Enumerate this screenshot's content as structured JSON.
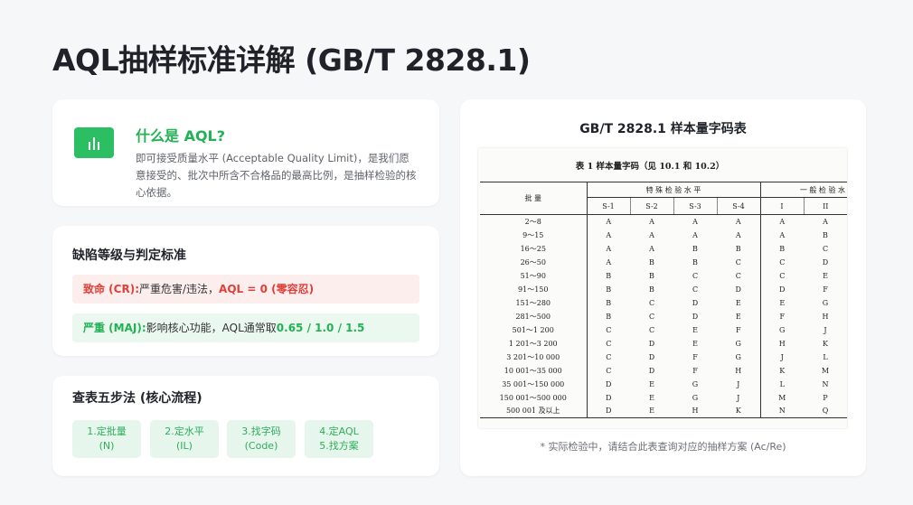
{
  "page": {
    "title": "AQL抽样标准详解 (GB/T 2828.1)"
  },
  "aql_card": {
    "heading": "什么是 AQL?",
    "description": "即可接受质量水平 (Acceptable Quality Limit)，是我们愿意接受的、批次中所含不合格品的最高比例，是抽样检验的核心依据。",
    "icon": "bar-chart-icon"
  },
  "defects": {
    "title": "缺陷等级与判定标准",
    "cr": {
      "label": "致命 (CR):",
      "text": "严重危害/违法，",
      "highlight": "AQL = 0 (零容忍)"
    },
    "maj": {
      "label": "严重 (MAJ):",
      "text": "影响核心功能，AQL通常取",
      "highlight": "0.65 / 1.0 / 1.5"
    }
  },
  "steps": {
    "title": "查表五步法 (核心流程)",
    "items": [
      {
        "line1": "1.定批量",
        "line2": "(N)"
      },
      {
        "line1": "2.定水平",
        "line2": "(IL)"
      },
      {
        "line1": "3.找字码",
        "line2": "(Code)"
      },
      {
        "line1": "4.定AQL",
        "line2": "5.找方案"
      }
    ]
  },
  "table_card": {
    "title": "GB/T 2828.1 样本量字码表",
    "scan_caption": "表 1   样本量字码（见 10.1 和 10.2）",
    "headers": {
      "batch": "批      量",
      "special": "特 殊 检 验 水 平",
      "general": "一 般 检 验 水",
      "sub": [
        "S-1",
        "S-2",
        "S-3",
        "S-4",
        "I",
        "II"
      ]
    },
    "rows": [
      [
        "2～8",
        "A",
        "A",
        "A",
        "A",
        "A",
        "A"
      ],
      [
        "9～15",
        "A",
        "A",
        "A",
        "A",
        "A",
        "B"
      ],
      [
        "16～25",
        "A",
        "A",
        "B",
        "B",
        "B",
        "C"
      ],
      [
        "26～50",
        "A",
        "B",
        "B",
        "C",
        "C",
        "D"
      ],
      [
        "51～90",
        "B",
        "B",
        "C",
        "C",
        "C",
        "E"
      ],
      [
        "91～150",
        "B",
        "B",
        "C",
        "D",
        "D",
        "F"
      ],
      [
        "151～280",
        "B",
        "C",
        "D",
        "E",
        "E",
        "G"
      ],
      [
        "281～500",
        "B",
        "C",
        "D",
        "E",
        "F",
        "H"
      ],
      [
        "501～1 200",
        "C",
        "C",
        "E",
        "F",
        "G",
        "J"
      ],
      [
        "1 201～3 200",
        "C",
        "D",
        "E",
        "G",
        "H",
        "K"
      ],
      [
        "3 201～10 000",
        "C",
        "D",
        "F",
        "G",
        "J",
        "L"
      ],
      [
        "10 001～35 000",
        "C",
        "D",
        "F",
        "H",
        "K",
        "M"
      ],
      [
        "35 001～150 000",
        "D",
        "E",
        "G",
        "J",
        "L",
        "N"
      ],
      [
        "150 001～500 000",
        "D",
        "E",
        "G",
        "J",
        "M",
        "P"
      ],
      [
        "500 001 及以上",
        "D",
        "E",
        "H",
        "K",
        "N",
        "Q"
      ]
    ],
    "note": "* 实际检验中，请结合此表查询对应的抽样方案 (Ac/Re)"
  }
}
